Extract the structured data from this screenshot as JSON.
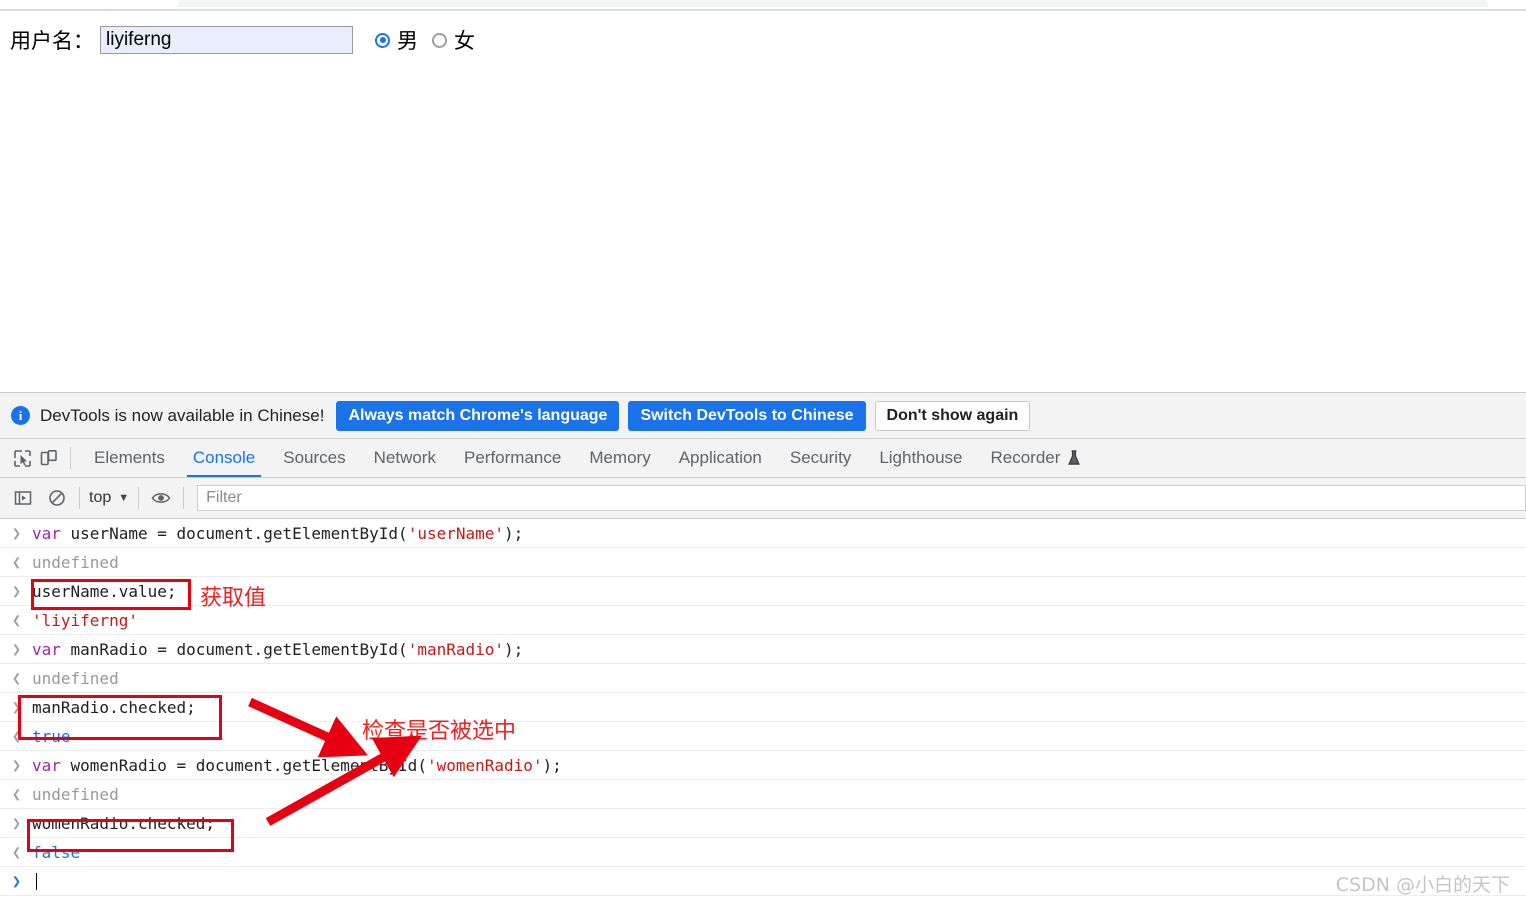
{
  "page_form": {
    "username_label": "用户名：",
    "username_value": "liyiferng",
    "gender_options": [
      {
        "label": "男",
        "checked": true
      },
      {
        "label": "女",
        "checked": false
      }
    ]
  },
  "devtools": {
    "banner": {
      "info_icon": "info-icon",
      "message": "DevTools is now available in Chinese!",
      "buttons": [
        {
          "label": "Always match Chrome's language",
          "style": "primary"
        },
        {
          "label": "Switch DevTools to Chinese",
          "style": "primary"
        },
        {
          "label": "Don't show again",
          "style": "secondary"
        }
      ]
    },
    "toolbar_icons": [
      {
        "name": "inspect-element-icon"
      },
      {
        "name": "device-toolbar-icon"
      }
    ],
    "tabs": [
      {
        "label": "Elements",
        "active": false
      },
      {
        "label": "Console",
        "active": true
      },
      {
        "label": "Sources",
        "active": false
      },
      {
        "label": "Network",
        "active": false
      },
      {
        "label": "Performance",
        "active": false
      },
      {
        "label": "Memory",
        "active": false
      },
      {
        "label": "Application",
        "active": false
      },
      {
        "label": "Security",
        "active": false
      },
      {
        "label": "Lighthouse",
        "active": false
      },
      {
        "label": "Recorder",
        "active": false,
        "icon": "flask-icon"
      }
    ],
    "console_toolbar": {
      "sidebar_toggle_icon": "console-sidebar-icon",
      "clear_icon": "clear-console-icon",
      "context": "top",
      "context_caret": "▼",
      "eye_icon": "live-expression-eye-icon",
      "filter_placeholder": "Filter",
      "filter_value": ""
    },
    "console_log": [
      {
        "kind": "input",
        "gutter": "❯",
        "segments": [
          {
            "t": "var ",
            "c": "kw"
          },
          {
            "t": "userName = document.getElementById(",
            "c": "code"
          },
          {
            "t": "'userName'",
            "c": "str"
          },
          {
            "t": ");",
            "c": "code"
          }
        ]
      },
      {
        "kind": "output",
        "gutter": "❮",
        "segments": [
          {
            "t": "undefined",
            "c": "undef"
          }
        ]
      },
      {
        "kind": "input",
        "gutter": "❯",
        "segments": [
          {
            "t": "userName.value;",
            "c": "code"
          }
        ]
      },
      {
        "kind": "output",
        "gutter": "❮",
        "segments": [
          {
            "t": "'liyiferng'",
            "c": "str"
          }
        ]
      },
      {
        "kind": "input",
        "gutter": "❯",
        "segments": [
          {
            "t": "var ",
            "c": "kw"
          },
          {
            "t": "manRadio = document.getElementById(",
            "c": "code"
          },
          {
            "t": "'manRadio'",
            "c": "str"
          },
          {
            "t": ");",
            "c": "code"
          }
        ]
      },
      {
        "kind": "output",
        "gutter": "❮",
        "segments": [
          {
            "t": "undefined",
            "c": "undef"
          }
        ]
      },
      {
        "kind": "input",
        "gutter": "❯",
        "segments": [
          {
            "t": "manRadio.checked;",
            "c": "code"
          }
        ]
      },
      {
        "kind": "output",
        "gutter": "❮",
        "segments": [
          {
            "t": "true",
            "c": "bool"
          }
        ]
      },
      {
        "kind": "input",
        "gutter": "❯",
        "segments": [
          {
            "t": "var ",
            "c": "kw"
          },
          {
            "t": "womenRadio = document.getElementById(",
            "c": "code"
          },
          {
            "t": "'womenRadio'",
            "c": "str"
          },
          {
            "t": ");",
            "c": "code"
          }
        ]
      },
      {
        "kind": "output",
        "gutter": "❮",
        "segments": [
          {
            "t": "undefined",
            "c": "undef"
          }
        ]
      },
      {
        "kind": "input",
        "gutter": "❯",
        "segments": [
          {
            "t": "womenRadio.checked;",
            "c": "code"
          }
        ]
      },
      {
        "kind": "output",
        "gutter": "❮",
        "segments": [
          {
            "t": "false",
            "c": "bool"
          }
        ]
      },
      {
        "kind": "prompt",
        "gutter": "❯",
        "segments": []
      }
    ]
  },
  "annotations": {
    "labels": [
      {
        "text": "获取值"
      },
      {
        "text": "检查是否被选中"
      }
    ],
    "accent_color": "#e60012",
    "text_color": "#ef2121"
  },
  "watermark": "CSDN @小白的天下"
}
